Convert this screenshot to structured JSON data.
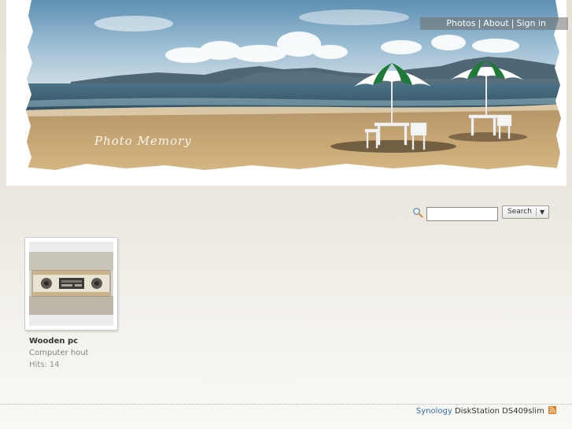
{
  "nav": {
    "items": [
      {
        "label": "Photos"
      },
      {
        "label": "About"
      },
      {
        "label": "Sign in"
      }
    ],
    "separator": "|"
  },
  "banner": {
    "title": "Photo Memory"
  },
  "search": {
    "placeholder": "",
    "value": "",
    "button_label": "Search"
  },
  "albums": [
    {
      "title": "Wooden pc",
      "description": "Computer hout",
      "hits_label": "Hits:",
      "hits": "14"
    }
  ],
  "footer": {
    "brand": "Synology",
    "product": "DiskStation DS409slim"
  },
  "colors": {
    "link": "#2a6db4",
    "rss": "#f07a1a"
  },
  "icons": {
    "search": "magnifier-icon",
    "rss": "rss-icon",
    "dropdown": "chevron-down-icon"
  }
}
